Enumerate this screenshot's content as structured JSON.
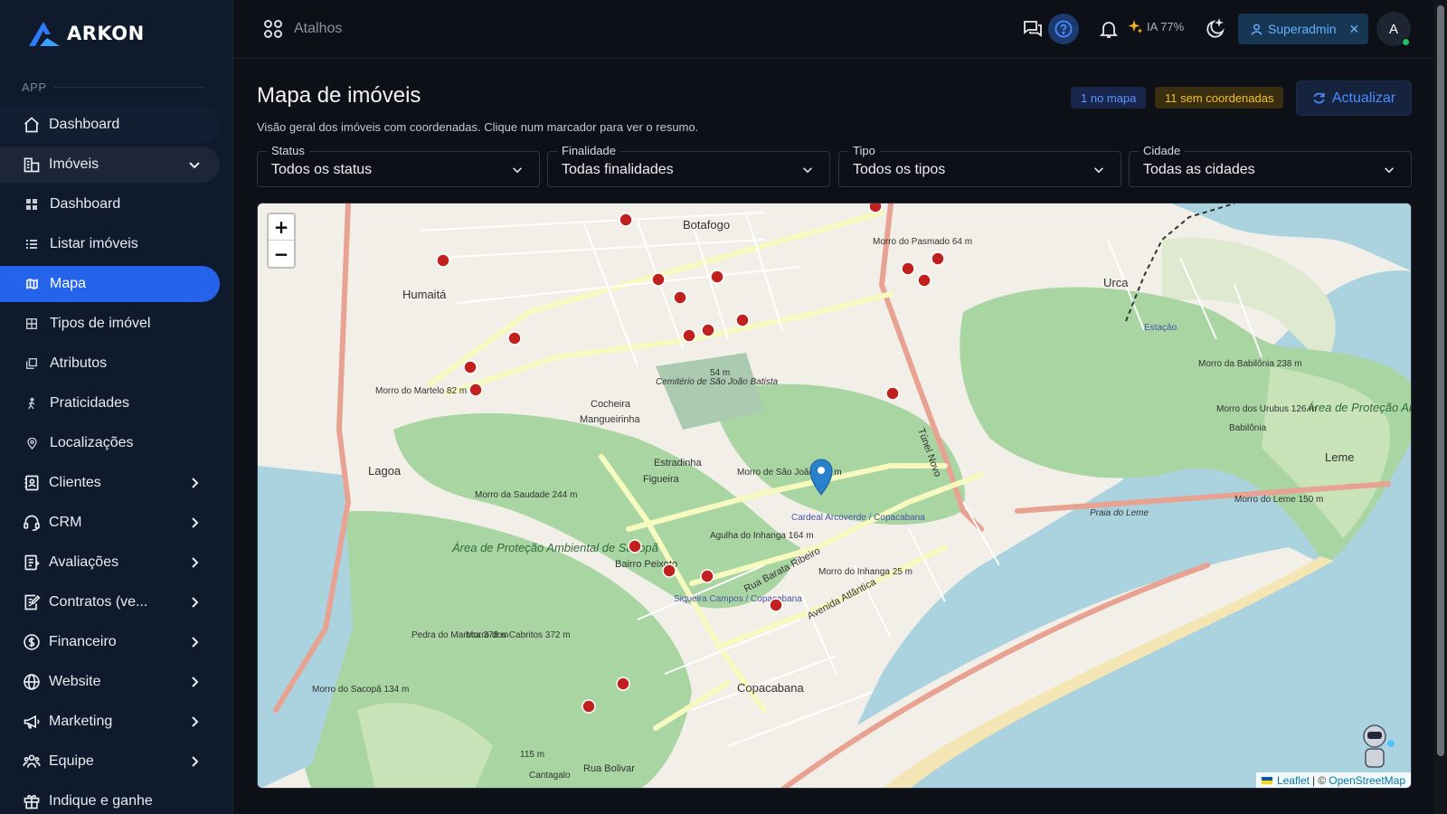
{
  "app": {
    "brand": "ARKON",
    "section_label": "APP"
  },
  "sidebar": {
    "items": [
      {
        "label": "Dashboard",
        "icon": "home-icon"
      },
      {
        "label": "Imóveis",
        "icon": "building-icon",
        "expanded": true
      },
      {
        "label": "Clientes",
        "icon": "contacts-icon"
      },
      {
        "label": "CRM",
        "icon": "headset-icon"
      },
      {
        "label": "Avaliações",
        "icon": "clipboard-icon"
      },
      {
        "label": "Contratos (ve...",
        "icon": "contract-icon"
      },
      {
        "label": "Financeiro",
        "icon": "dollar-icon"
      },
      {
        "label": "Website",
        "icon": "globe-icon"
      },
      {
        "label": "Marketing",
        "icon": "megaphone-icon"
      },
      {
        "label": "Equipe",
        "icon": "team-icon"
      },
      {
        "label": "Indique e ganhe",
        "icon": "gift-icon"
      }
    ],
    "sub_items": [
      {
        "label": "Dashboard"
      },
      {
        "label": "Listar imóveis"
      },
      {
        "label": "Mapa",
        "active": true
      },
      {
        "label": "Tipos de imóvel"
      },
      {
        "label": "Atributos"
      },
      {
        "label": "Praticidades"
      },
      {
        "label": "Localizações"
      }
    ]
  },
  "topbar": {
    "shortcuts_label": "Atalhos",
    "ia_label": "IA 77%",
    "role_label": "Superadmin",
    "avatar_initial": "A"
  },
  "main": {
    "title": "Mapa de imóveis",
    "description": "Visão geral dos imóveis com coordenadas. Clique num marcador para ver o resumo.",
    "badge_on_map": "1 no mapa",
    "badge_no_coords": "11 sem coordenadas",
    "refresh_label": "Actualizar",
    "filters": [
      {
        "label": "Status",
        "value": "Todos os status"
      },
      {
        "label": "Finalidade",
        "value": "Todas finalidades"
      },
      {
        "label": "Tipo",
        "value": "Todos os tipos"
      },
      {
        "label": "Cidade",
        "value": "Todas as cidades"
      }
    ]
  },
  "map": {
    "zoom_in": "+",
    "zoom_out": "−",
    "attribution_leaflet": "Leaflet",
    "attribution_sep": "| ©",
    "attribution_osm": "OpenStreetMap",
    "labels": [
      "Botafogo",
      "Humaitá",
      "Urca",
      "Lagoa",
      "Leme",
      "Copacabana",
      "Cocheira",
      "Mangueirinha",
      "Estradinha",
      "Figueira",
      "Bairro Peixoto",
      "Babilônia",
      "Cardeal Arcoverde / Copacabana",
      "Siqueira Campos / Copacabana",
      "Área de Proteção Ambiental de Sacopã",
      "Área de Proteção Ambiental do Morro do Leme, Urubu e Ilha de Cotunduba",
      "Morro da Babilônia 238 m",
      "Morro do Pasmado 64 m",
      "Morro do Martelo 82 m",
      "Morro da Saudade 244 m",
      "Morro de São João 242 m",
      "Morro dos Cabritos 372 m",
      "Pedra do Maroca 378 m",
      "Morro do Sacopã 134 m",
      "Morro dos Urubus 126 m",
      "Morro do Leme 150 m",
      "Morro do Inhanga 25 m",
      "Agulha do Inhanga 164 m",
      "Cemitério de São João Batista",
      "Avenida Atlântica",
      "Rua Barata Ribeiro",
      "Túnel Novo",
      "Praia do Leme",
      "Rua Bolivar",
      "Cantagalo",
      "Estação",
      "115 m",
      "54 m"
    ],
    "marker_selected": "Cardeal Arcoverde / Copacabana"
  }
}
